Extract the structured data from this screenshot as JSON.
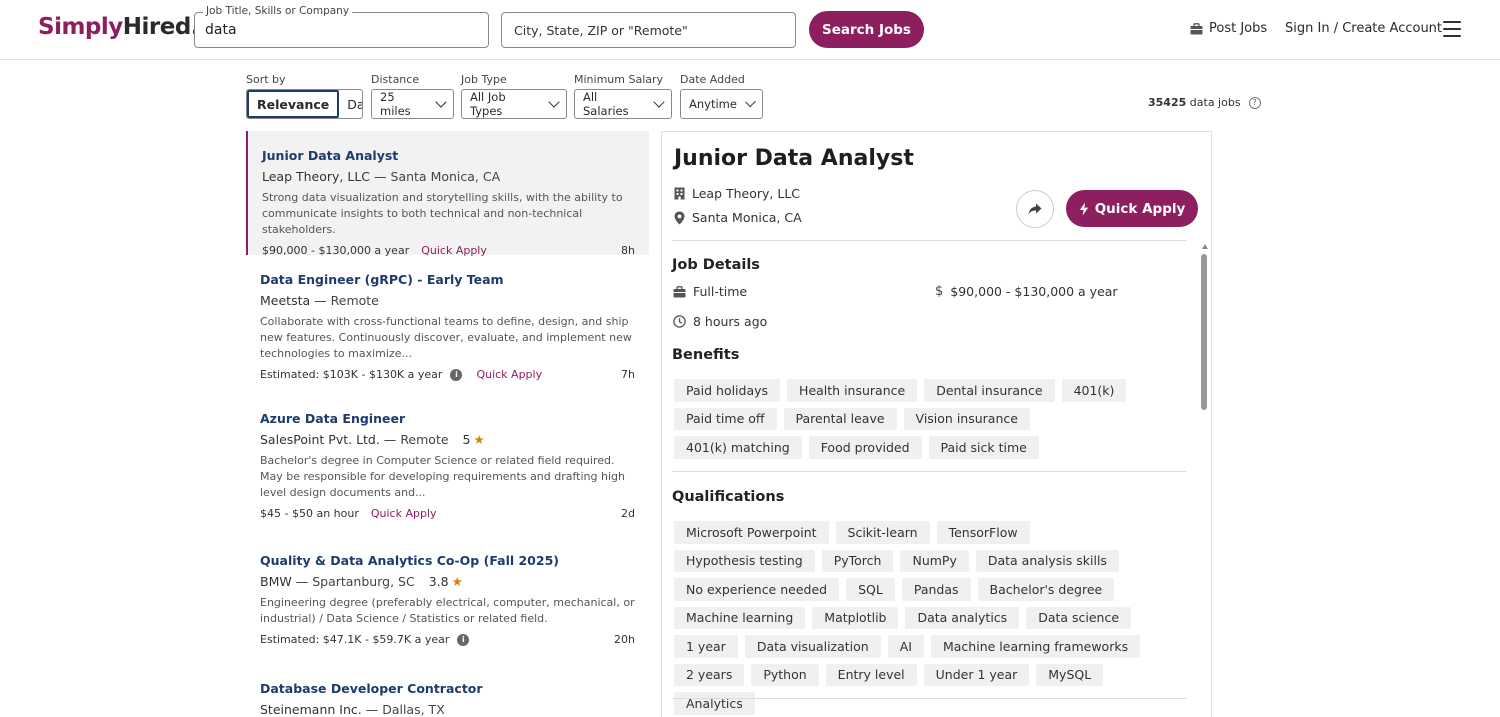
{
  "header": {
    "logo_part1": "Simply",
    "logo_part2": "Hired.",
    "what_label": "Job Title, Skills or Company",
    "what_value": "data",
    "where_placeholder": "City, State, ZIP or \"Remote\"",
    "search_label": "Search Jobs",
    "post_jobs": "Post Jobs",
    "sign_in": "Sign In / Create Account"
  },
  "filters": {
    "sort_label": "Sort by",
    "sort_options": [
      "Relevance",
      "Date"
    ],
    "distance_label": "Distance",
    "distance_value": "25 miles",
    "jobtype_label": "Job Type",
    "jobtype_value": "All Job Types",
    "salary_label": "Minimum Salary",
    "salary_value": "All Salaries",
    "date_label": "Date Added",
    "date_value": "Anytime",
    "count_number": "35425",
    "count_text": "data jobs"
  },
  "jobs": [
    {
      "title": "Junior Data Analyst",
      "company": "Leap Theory, LLC —",
      "location": "Santa Monica, CA",
      "snippet": "Strong data visualization and storytelling skills, with the ability to communicate insights to both technical and non-technical stakeholders.",
      "salary": "$90,000 - $130,000 a year",
      "quick_apply": "Quick Apply",
      "age": "8h"
    },
    {
      "title": "Data Engineer (gRPC) - Early Team",
      "company": "Meetsta —",
      "location": "Remote",
      "snippet": "Collaborate with cross-functional teams to define, design, and ship new features. Continuously discover, evaluate, and implement new technologies to maximize...",
      "salary": "Estimated: $103K - $130K a year",
      "quick_apply": "Quick Apply",
      "age": "7h"
    },
    {
      "title": "Azure Data Engineer",
      "company": "SalesPoint Pvt. Ltd. —",
      "location": "Remote",
      "rating": "5",
      "snippet": "Bachelor's degree in Computer Science or related field required. May be responsible for developing requirements and drafting high level design documents and...",
      "salary": "$45 - $50 an hour",
      "quick_apply": "Quick Apply",
      "age": "2d"
    },
    {
      "title": "Quality & Data Analytics Co-Op (Fall 2025)",
      "company": "BMW —",
      "location": "Spartanburg, SC",
      "rating": "3.8",
      "snippet": "Engineering degree (preferably electrical, computer, mechanical, or industrial) / Data Science / Statistics or related field.",
      "salary": "Estimated: $47.1K - $59.7K a year",
      "age": "20h"
    },
    {
      "title": "Database Developer Contractor",
      "company": "Steinemann Inc. —",
      "location": "Dallas, TX"
    }
  ],
  "detail": {
    "title": "Junior Data Analyst",
    "company": "Leap Theory, LLC",
    "location": "Santa Monica, CA",
    "quick_apply": "Quick Apply",
    "job_details_title": "Job Details",
    "job_type": "Full-time",
    "salary": "$90,000 - $130,000 a year",
    "posted": "8 hours ago",
    "benefits_title": "Benefits",
    "benefits": [
      "Paid holidays",
      "Health insurance",
      "Dental insurance",
      "401(k)",
      "Paid time off",
      "Parental leave",
      "Vision insurance",
      "401(k) matching",
      "Food provided",
      "Paid sick time"
    ],
    "qualifications_title": "Qualifications",
    "qualifications": [
      "Microsoft Powerpoint",
      "Scikit-learn",
      "TensorFlow",
      "Hypothesis testing",
      "PyTorch",
      "NumPy",
      "Data analysis skills",
      "No experience needed",
      "SQL",
      "Pandas",
      "Bachelor's degree",
      "Machine learning",
      "Matplotlib",
      "Data analytics",
      "Data science",
      "1 year",
      "Data visualization",
      "AI",
      "Machine learning frameworks",
      "2 years",
      "Python",
      "Entry level",
      "Under 1 year",
      "MySQL",
      "Analytics"
    ]
  },
  "colors": {
    "brand": "#8e1f5f",
    "link": "#1f3b6e",
    "star": "#d4830f"
  }
}
